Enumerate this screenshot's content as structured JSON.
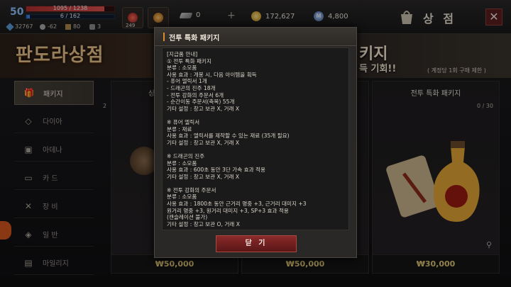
{
  "player": {
    "level": "50",
    "hp_text": "1095 / 1238",
    "hp_fraction": 0.884,
    "mp_text": "6 / 162",
    "mp_fraction": 0.037,
    "stats": [
      "32767",
      "-62",
      "80",
      "3"
    ]
  },
  "slots": [
    {
      "icon": "potion-icon",
      "count": "249"
    },
    {
      "icon": "elixir-icon",
      "count": ""
    }
  ],
  "currency": [
    {
      "icon": "feather-icon",
      "value": "0"
    },
    {
      "icon": "gold-coin-icon",
      "value": "172,627"
    },
    {
      "icon": "mileage-coin-icon",
      "value": "4,800"
    }
  ],
  "header": {
    "title": "상 점",
    "close_label": "✕"
  },
  "banner": {
    "title": "판도라상점",
    "right_line1": "키지",
    "right_line2": "득 기회!!",
    "note": "( 계정당 1회 구매 제한 )"
  },
  "sidebar": [
    {
      "icon": "gift-icon",
      "label": "패키지",
      "active": true
    },
    {
      "icon": "diamond-icon",
      "label": "다이아",
      "active": false
    },
    {
      "icon": "items-icon",
      "label": "아데나",
      "active": false
    },
    {
      "icon": "card-icon",
      "label": "카 드",
      "active": false
    },
    {
      "icon": "swords-icon",
      "label": "장 비",
      "active": false
    },
    {
      "icon": "cube-icon",
      "label": "일 반",
      "active": false
    },
    {
      "icon": "mileage-icon",
      "label": "마일리지",
      "active": false
    }
  ],
  "products": [
    {
      "title": "상",
      "count": "2",
      "price": "₩50,000"
    },
    {
      "title": "",
      "count": "2",
      "price": "₩50,000"
    },
    {
      "title": "전투 특화 패키지",
      "count": "0 / 30",
      "price": "₩30,000"
    }
  ],
  "modal": {
    "title": "전투 특화 패키지",
    "button": "닫 기",
    "lines": [
      "[지급품 안내]",
      "① 전투 특화 패키지",
      "분류 : 소모품",
      "사용 효과 : 개봉 시, 다음 아이템을 획득",
      "- 퓨어 엘릭서 1개",
      "- 드래곤의 진주 18개",
      "- 전투 강화의 주문서 6개",
      "- 순간이동 주문서(축복) 55개",
      "기타 설정 : 창고 보관 X, 거래 X",
      "",
      "※ 퓨어 엘릭서",
      "분류 : 재료",
      "사용 효과 : 엘릭서를 제작할 수 있는 재료 (35개 필요)",
      "기타 설정 : 창고 보관 X, 거래 X",
      "",
      "※ 드래곤의 진주",
      "분류 : 소모품",
      "사용 효과 : 600초 동안 3단 가속 효과 적용",
      "기타 설정 : 창고 보관 X, 거래 X",
      "",
      "※ 전투 강화의 주문서",
      "분류 : 소모품",
      "사용 효과 : 1800초 동안 근거리 명중 +3, 근거리 대미지 +3",
      "원거리 명중 +3, 원거리 대미지 +3, SP+3 효과 적용",
      "(캔슬레이션 불가)",
      "기타 설정 : 창고 보관 O, 거래 X",
      "",
      "※ 순간이동 주문서(축복)"
    ]
  }
}
